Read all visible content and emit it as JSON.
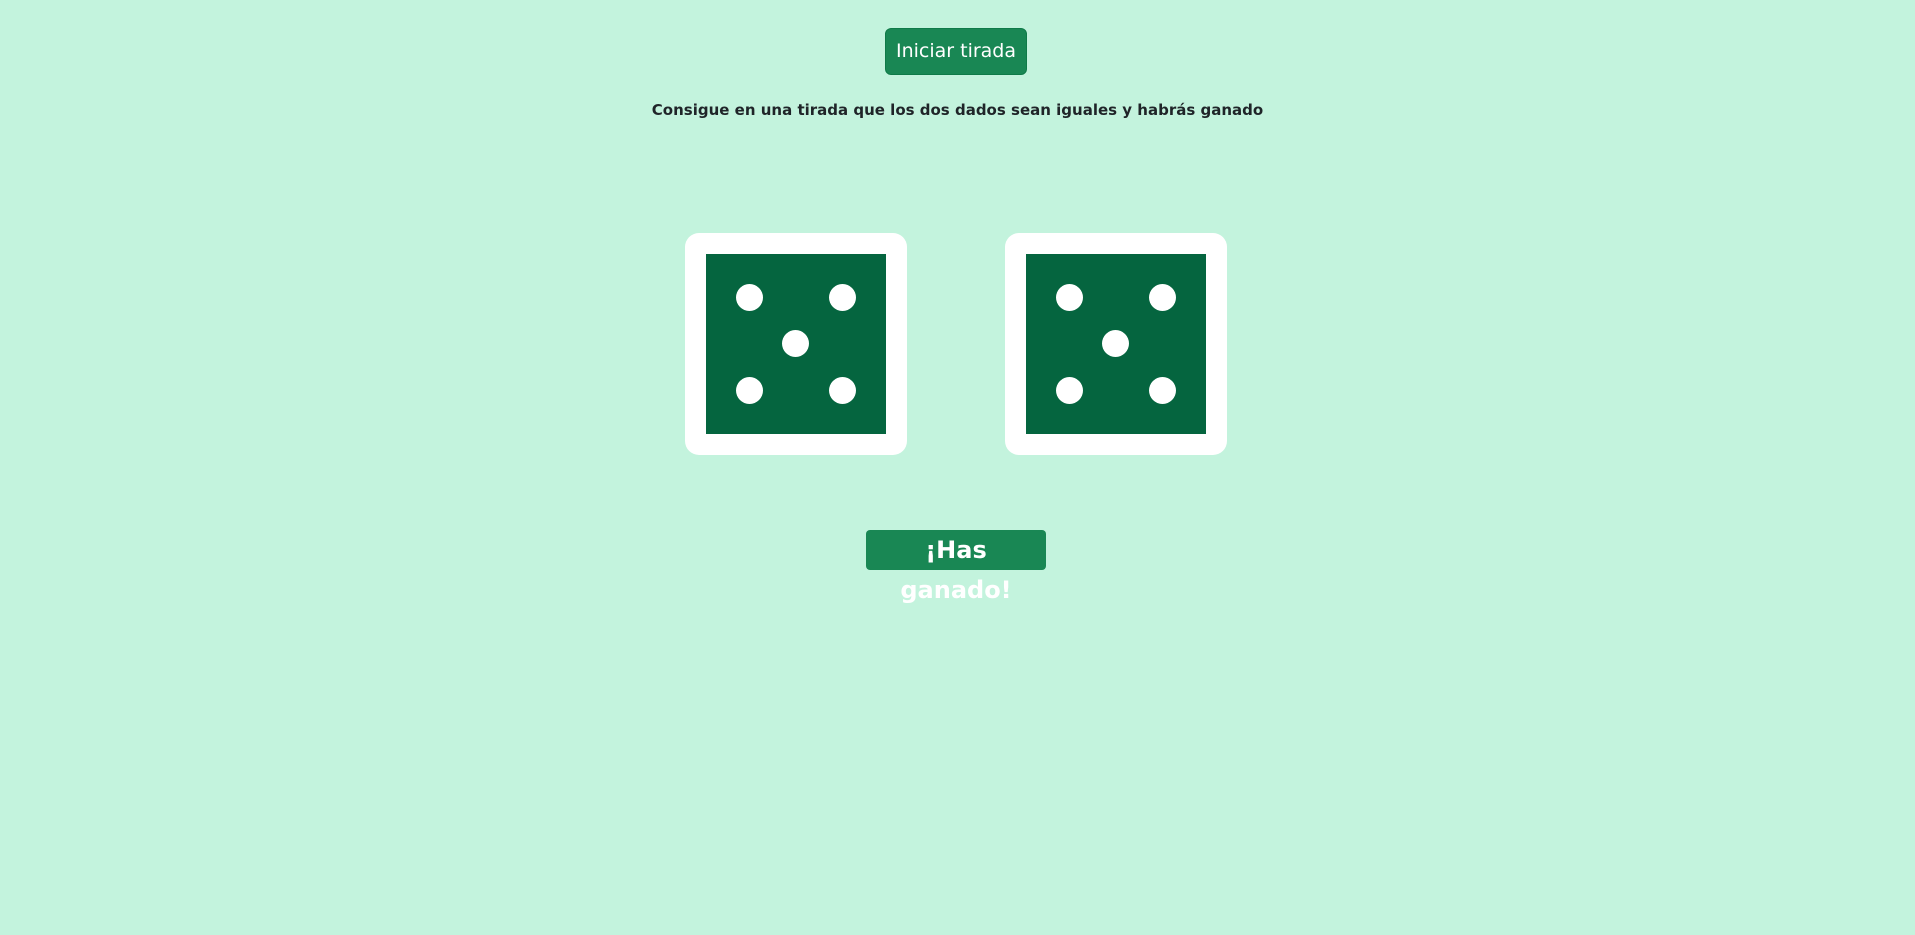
{
  "controls": {
    "roll_button_label": "Iniciar tirada"
  },
  "instructions": "Consigue en una tirada que los dos dados sean iguales y habrás ganado",
  "dice": [
    {
      "value": 5
    },
    {
      "value": 5
    }
  ],
  "result": {
    "label": "¡Has ganado!"
  },
  "colors": {
    "background": "#c3f3dd",
    "button": "#198754",
    "die_face": "#05653f",
    "pip": "#ffffff"
  }
}
